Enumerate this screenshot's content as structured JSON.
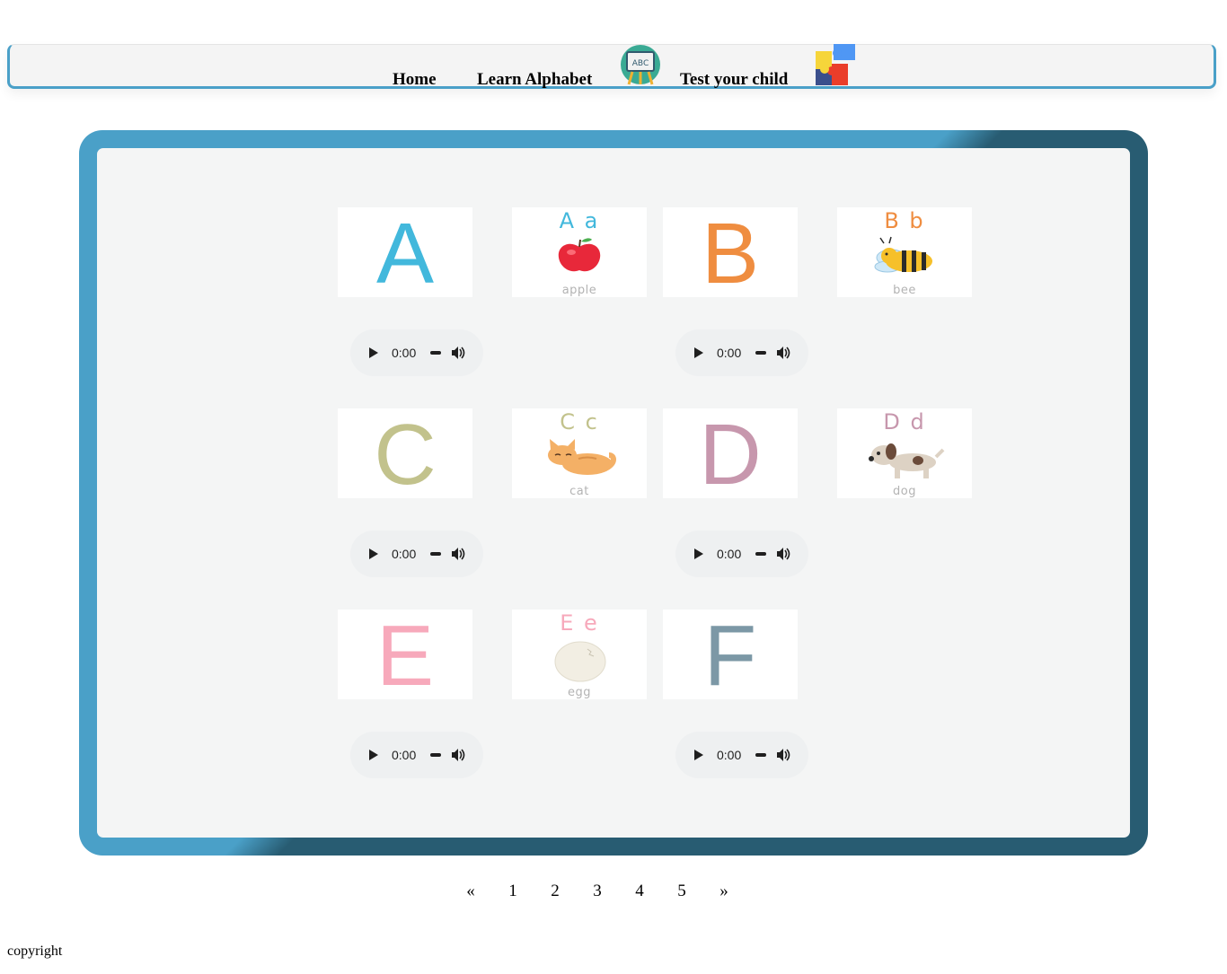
{
  "nav": {
    "home": "Home",
    "learn_alphabet": "Learn Alphabet",
    "learn_icon": "abc-easel-icon",
    "learn_icon_text": "ABC",
    "test_child": "Test your child",
    "test_icon": "puzzle-pieces-icon"
  },
  "cards": [
    {
      "letter": "A",
      "color": "#42b8dc"
    },
    {
      "pair": "A a",
      "word": "apple",
      "color": "#42b8dc",
      "picture": "apple-icon"
    },
    {
      "letter": "B",
      "color": "#ef8d40"
    },
    {
      "pair": "B b",
      "word": "bee",
      "color": "#ef8d40",
      "picture": "bee-icon"
    },
    {
      "letter": "C",
      "color": "#c2c28c"
    },
    {
      "pair": "C c",
      "word": "cat",
      "color": "#c2c28c",
      "picture": "cat-icon"
    },
    {
      "letter": "D",
      "color": "#c797ad"
    },
    {
      "pair": "D d",
      "word": "dog",
      "color": "#c797ad",
      "picture": "dog-icon"
    },
    {
      "letter": "E",
      "color": "#f7a9bb"
    },
    {
      "pair": "E e",
      "word": "egg",
      "color": "#f7a9bb",
      "picture": "egg-icon"
    },
    {
      "letter": "F",
      "color": "#7c98a6"
    }
  ],
  "audio": {
    "time": "0:00",
    "play_icon": "play-icon",
    "volume_icon": "volume-icon"
  },
  "pagination": {
    "prev": "«",
    "pages": [
      "1",
      "2",
      "3",
      "4",
      "5"
    ],
    "next": "»"
  },
  "footer": {
    "copyright": "copyright"
  },
  "colors": {
    "frame_light": "#4aa0c8",
    "frame_dark": "#285c72",
    "panel": "#f4f5f5"
  }
}
